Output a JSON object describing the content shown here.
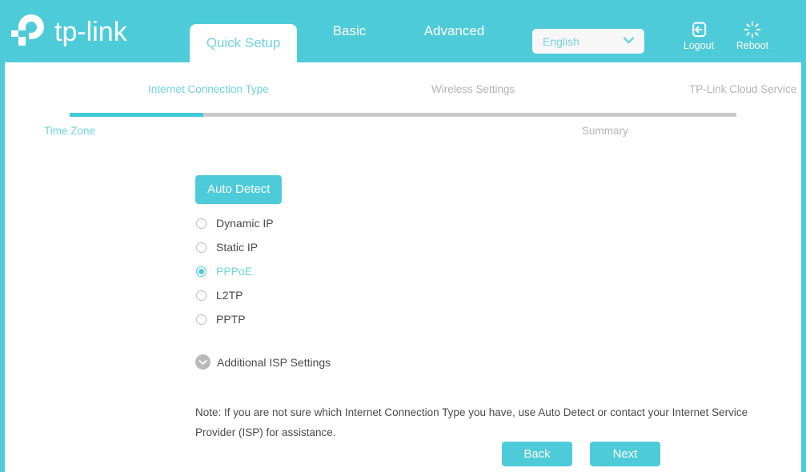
{
  "brand": {
    "name": "tp-link",
    "logo_icon": "tplink-logo-icon"
  },
  "header": {
    "tabs": [
      {
        "label": "Quick Setup",
        "active": true
      },
      {
        "label": "Basic",
        "active": false
      },
      {
        "label": "Advanced",
        "active": false
      }
    ],
    "language": {
      "value": "English",
      "caret_icon": "chevron-down-icon"
    },
    "actions": [
      {
        "label": "Logout",
        "icon": "logout-icon"
      },
      {
        "label": "Reboot",
        "icon": "reboot-icon"
      }
    ],
    "bg_color": "#4ecbd9"
  },
  "stepper": {
    "steps": [
      {
        "label": "Internet Connection Type",
        "active": true
      },
      {
        "label": "Wireless Settings",
        "active": false
      },
      {
        "label": "TP-Link Cloud Service",
        "active": false
      },
      {
        "label": "Time Zone",
        "active": true
      },
      {
        "label": "Summary",
        "active": false
      }
    ],
    "progress_percent": 20,
    "fill_color": "#3fc8d8",
    "track_color": "#c9c9c9"
  },
  "main": {
    "auto_detect_label": "Auto Detect",
    "connection_types": [
      {
        "label": "Dynamic IP",
        "selected": false
      },
      {
        "label": "Static IP",
        "selected": false
      },
      {
        "label": "PPPoE",
        "selected": true
      },
      {
        "label": "L2TP",
        "selected": false
      },
      {
        "label": "PPTP",
        "selected": false
      }
    ],
    "additional_isp": {
      "label": "Additional ISP Settings",
      "caret_icon": "chevron-down-circle-icon",
      "expanded": false
    },
    "note": "Note: If you are not sure which Internet Connection Type you have, use Auto Detect or contact your Internet Service Provider (ISP) for assistance.",
    "buttons": {
      "back_label": "Back",
      "next_label": "Next"
    },
    "accent_color": "#4ecbd9"
  }
}
